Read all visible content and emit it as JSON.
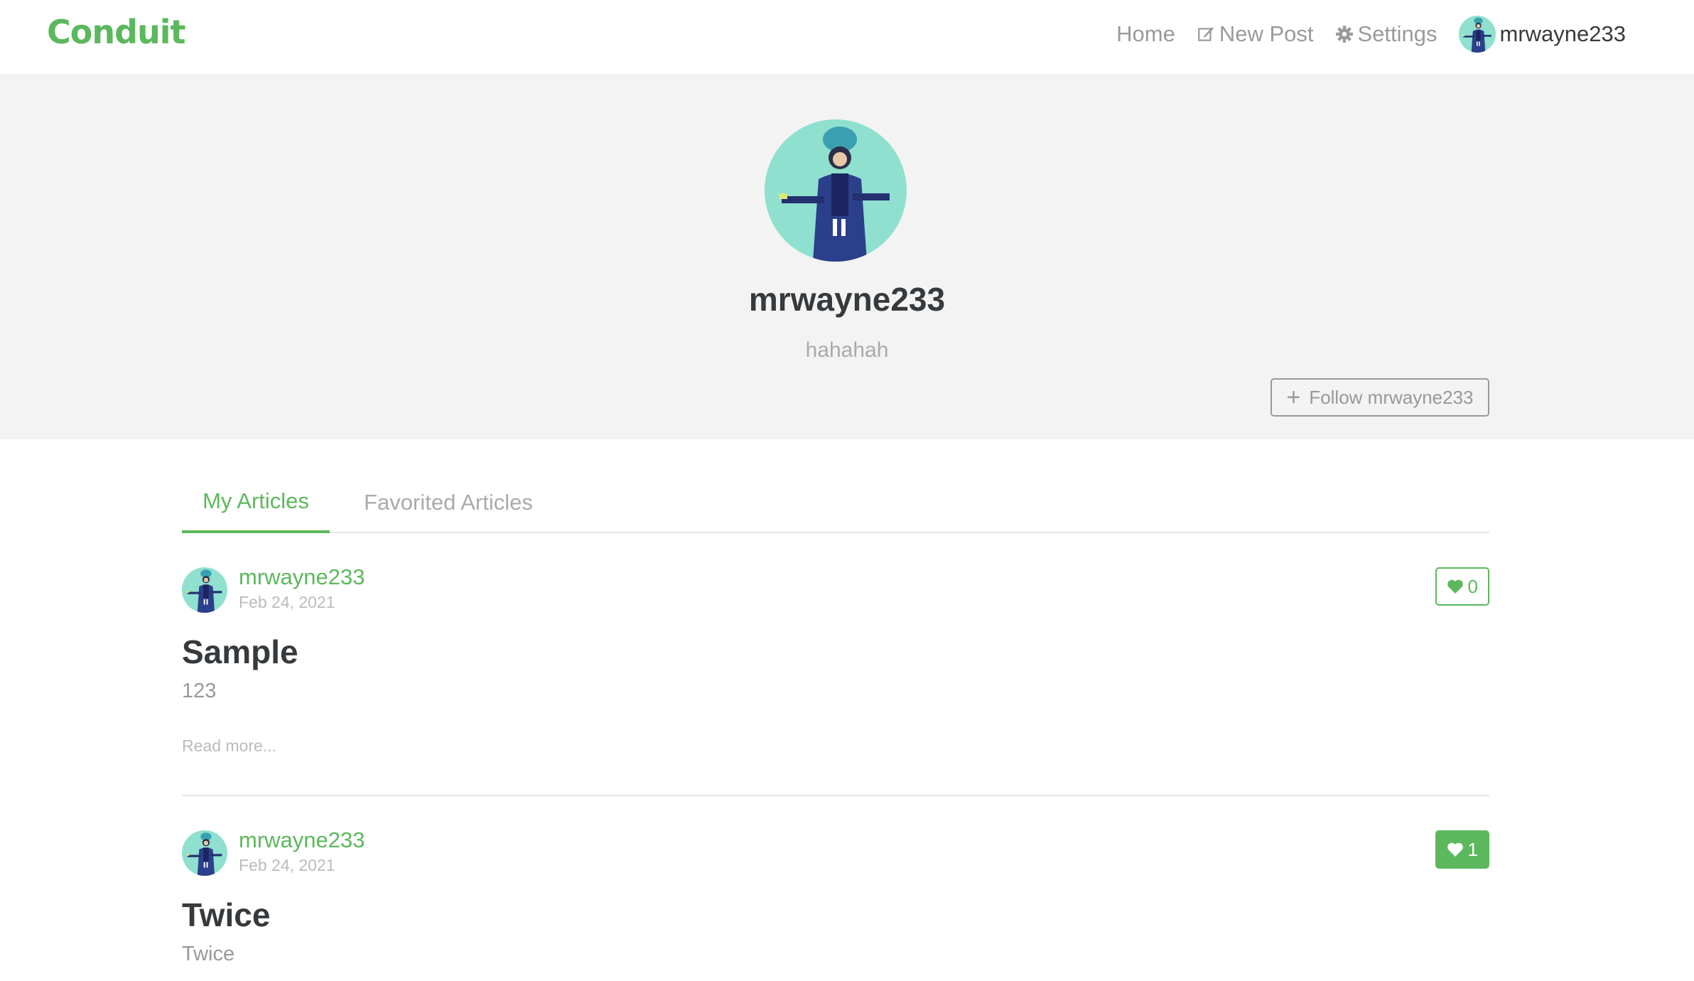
{
  "nav": {
    "brand": "Conduit",
    "home": "Home",
    "new_post": "New Post",
    "settings": "Settings",
    "username": "mrwayne233"
  },
  "profile": {
    "username": "mrwayne233",
    "bio": "hahahah",
    "follow_label": "Follow mrwayne233"
  },
  "tabs": {
    "my_articles": "My Articles",
    "favorited_articles": "Favorited Articles"
  },
  "articles": [
    {
      "author": "mrwayne233",
      "date": "Feb 24, 2021",
      "favorites": "0",
      "favorited": false,
      "title": "Sample",
      "description": "123",
      "read_more": "Read more..."
    },
    {
      "author": "mrwayne233",
      "date": "Feb 24, 2021",
      "favorites": "1",
      "favorited": true,
      "title": "Twice",
      "description": "Twice"
    }
  ],
  "colors": {
    "accent": "#5cb85c",
    "banner_bg": "#f3f3f3",
    "avatar_bg": "#8fe0cf"
  },
  "icons": {
    "new_post": "edit-icon",
    "settings": "gear-icon",
    "follow": "plus-icon",
    "favorite": "heart-icon"
  }
}
